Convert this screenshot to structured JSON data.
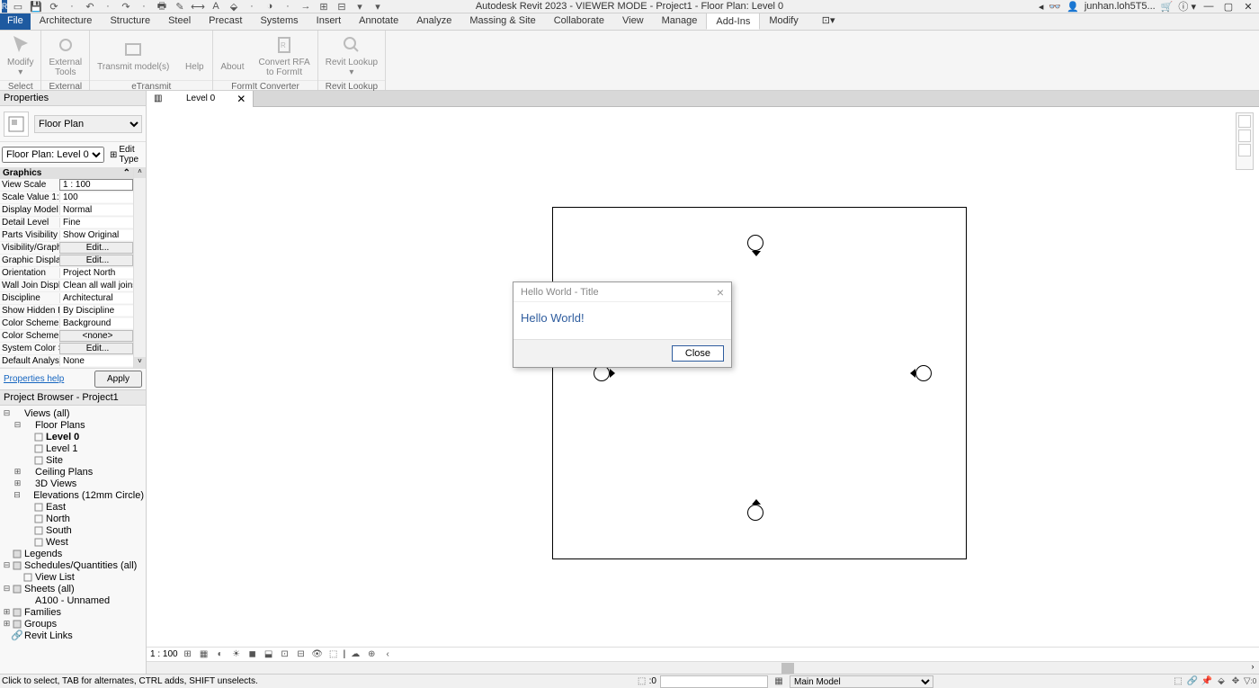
{
  "title": "Autodesk Revit 2023 - VIEWER MODE - Project1 - Floor Plan: Level 0",
  "user": "junhan.loh5T5...",
  "qat_icons": [
    "revit-logo",
    "open",
    "save",
    "sync",
    "undo",
    "redo",
    "measure",
    "print",
    "dim",
    "text",
    "cloud",
    "align",
    "dot",
    "arrow",
    "cut",
    "paste",
    "match",
    "dropdown"
  ],
  "tabs": [
    "File",
    "Architecture",
    "Structure",
    "Steel",
    "Precast",
    "Systems",
    "Insert",
    "Annotate",
    "Analyze",
    "Massing & Site",
    "Collaborate",
    "View",
    "Manage",
    "Add-Ins",
    "Modify"
  ],
  "active_tab": 13,
  "ribbon": {
    "groups": [
      {
        "label": "Select",
        "buttons": [
          {
            "t": "Modify",
            "sub": ""
          }
        ]
      },
      {
        "label": "External",
        "buttons": [
          {
            "t": "External",
            "sub": "Tools"
          }
        ]
      },
      {
        "label": "eTransmit",
        "buttons": [
          {
            "t": "Transmit model(s)",
            "sub": ""
          },
          {
            "t": "Help",
            "sub": ""
          }
        ]
      },
      {
        "label": "FormIt Converter",
        "buttons": [
          {
            "t": "About",
            "sub": ""
          },
          {
            "t": "Convert RFA",
            "sub": "to FormIt"
          }
        ]
      },
      {
        "label": "Revit Lookup",
        "buttons": [
          {
            "t": "Revit Lookup",
            "sub": ""
          }
        ]
      }
    ]
  },
  "properties": {
    "title": "Properties",
    "type_name": "Floor Plan",
    "instance": "Floor Plan: Level 0",
    "edit_type": "Edit Type",
    "cat": "Graphics",
    "rows": [
      {
        "k": "View Scale",
        "v": "1 : 100",
        "inp": true
      },
      {
        "k": "Scale Value    1:",
        "v": "100"
      },
      {
        "k": "Display Model",
        "v": "Normal"
      },
      {
        "k": "Detail Level",
        "v": "Fine"
      },
      {
        "k": "Parts Visibility",
        "v": "Show Original"
      },
      {
        "k": "Visibility/Graphic...",
        "v": "Edit...",
        "btn": true
      },
      {
        "k": "Graphic Display ...",
        "v": "Edit...",
        "btn": true
      },
      {
        "k": "Orientation",
        "v": "Project North"
      },
      {
        "k": "Wall Join Display",
        "v": "Clean all wall joins"
      },
      {
        "k": "Discipline",
        "v": "Architectural"
      },
      {
        "k": "Show Hidden Lin...",
        "v": "By Discipline"
      },
      {
        "k": "Color Scheme Lo...",
        "v": "Background"
      },
      {
        "k": "Color Scheme",
        "v": "<none>",
        "btn": true
      },
      {
        "k": "System Color Sch...",
        "v": "Edit...",
        "btn": true
      },
      {
        "k": "Default Analysis ...",
        "v": "None"
      }
    ],
    "help": "Properties help",
    "apply": "Apply"
  },
  "browser": {
    "title": "Project Browser - Project1",
    "tree": [
      {
        "d": 0,
        "tw": "-",
        "t": "Views (all)"
      },
      {
        "d": 1,
        "tw": "-",
        "t": "Floor Plans"
      },
      {
        "d": 2,
        "ic": "sheet",
        "t": "Level 0",
        "bold": true
      },
      {
        "d": 2,
        "ic": "sheet",
        "t": "Level 1"
      },
      {
        "d": 2,
        "ic": "sheet",
        "t": "Site"
      },
      {
        "d": 1,
        "tw": "+",
        "t": "Ceiling Plans"
      },
      {
        "d": 1,
        "tw": "+",
        "t": "3D Views"
      },
      {
        "d": 1,
        "tw": "-",
        "t": "Elevations (12mm Circle)"
      },
      {
        "d": 2,
        "ic": "sheet",
        "t": "East"
      },
      {
        "d": 2,
        "ic": "sheet",
        "t": "North"
      },
      {
        "d": 2,
        "ic": "sheet",
        "t": "South"
      },
      {
        "d": 2,
        "ic": "sheet",
        "t": "West"
      },
      {
        "d": 0,
        "ic": "leg",
        "t": "Legends"
      },
      {
        "d": 0,
        "tw": "-",
        "ic": "sch",
        "t": "Schedules/Quantities (all)"
      },
      {
        "d": 1,
        "ic": "sheet",
        "t": "View List"
      },
      {
        "d": 0,
        "tw": "-",
        "ic": "sht",
        "t": "Sheets (all)"
      },
      {
        "d": 1,
        "t": "A100 - Unnamed"
      },
      {
        "d": 0,
        "tw": "+",
        "ic": "fam",
        "t": "Families"
      },
      {
        "d": 0,
        "tw": "+",
        "ic": "grp",
        "t": "Groups"
      },
      {
        "d": 0,
        "ic": "link",
        "t": "Revit Links"
      }
    ]
  },
  "doc_tab": {
    "label": "Level 0"
  },
  "dialog": {
    "title": "Hello World - Title",
    "body": "Hello World!",
    "close": "Close"
  },
  "viewbar": {
    "scale": "1 : 100"
  },
  "status": {
    "msg": "Click to select, TAB for alternates, CTRL adds, SHIFT unselects.",
    "model": "Main Model",
    "sel_count": ":0"
  }
}
